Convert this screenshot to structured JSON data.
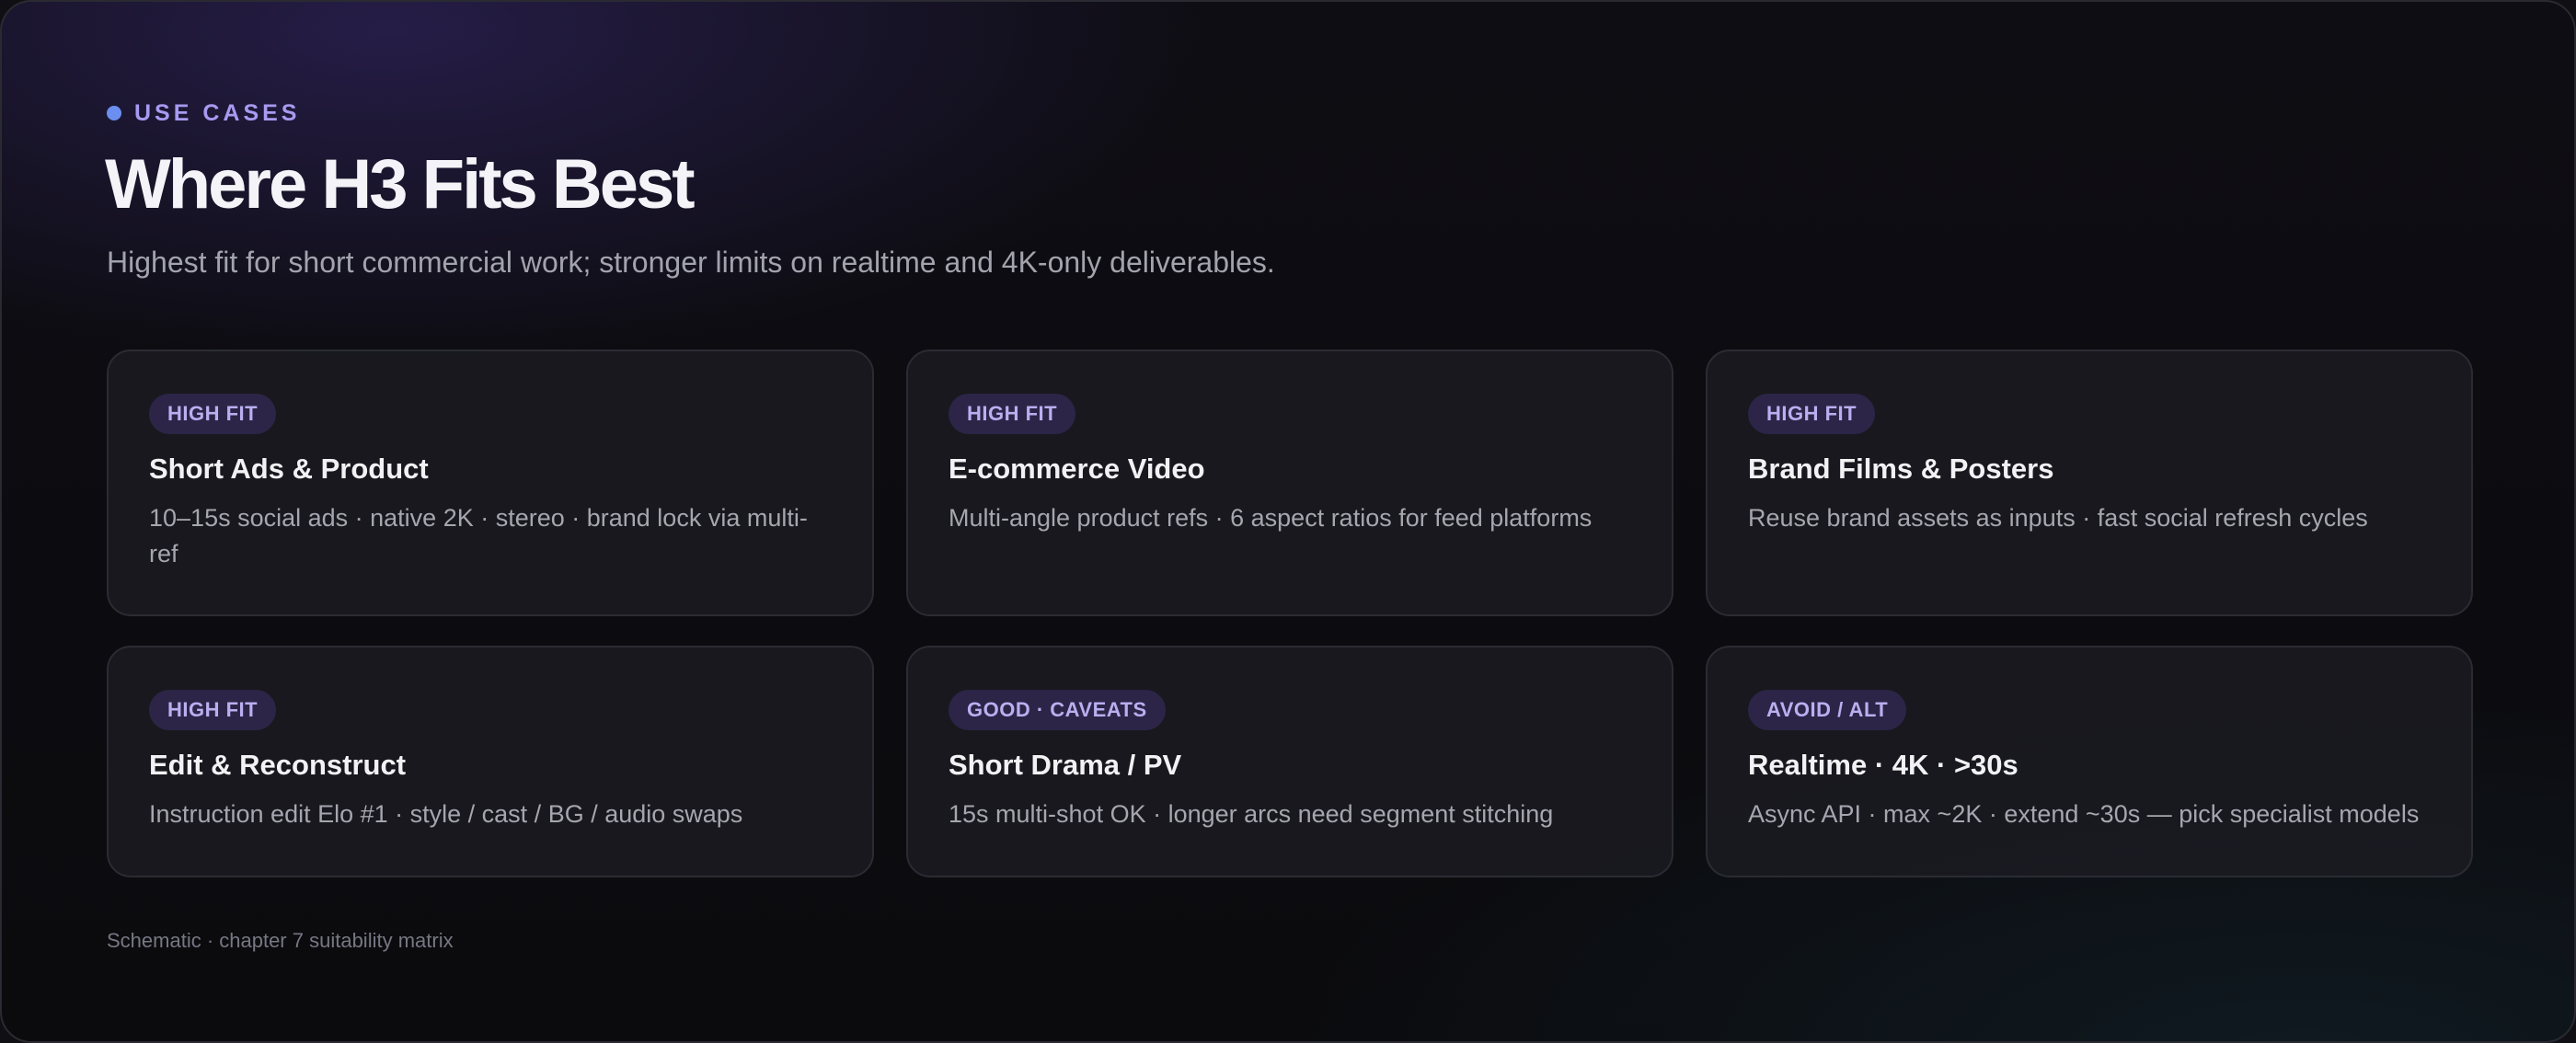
{
  "header": {
    "eyebrow": "USE CASES",
    "title": "Where H3 Fits Best",
    "subtitle": "Highest fit for short commercial work; stronger limits on realtime and 4K-only deliverables."
  },
  "cards": [
    {
      "badge": "HIGH FIT",
      "title": "Short Ads & Product",
      "description": "10–15s social ads · native 2K · stereo · brand lock via multi-ref"
    },
    {
      "badge": "HIGH FIT",
      "title": "E-commerce Video",
      "description": "Multi-angle product refs · 6 aspect ratios for feed platforms"
    },
    {
      "badge": "HIGH FIT",
      "title": "Brand Films & Posters",
      "description": "Reuse brand assets as inputs · fast social refresh cycles"
    },
    {
      "badge": "HIGH FIT",
      "title": "Edit & Reconstruct",
      "description": "Instruction edit Elo #1 · style / cast / BG / audio swaps"
    },
    {
      "badge": "GOOD · CAVEATS",
      "title": "Short Drama / PV",
      "description": "15s multi-shot OK · longer arcs need segment stitching"
    },
    {
      "badge": "AVOID / ALT",
      "title": "Realtime · 4K · >30s",
      "description": "Async API · max ~2K · extend ~30s — pick specialist models"
    }
  ],
  "footnote": "Schematic · chapter 7 suitability matrix",
  "colors": {
    "accent_dot": "#6b8ff0",
    "eyebrow": "#a79af0",
    "badge_bg": "#2c2547",
    "badge_text": "#b9aff0"
  }
}
